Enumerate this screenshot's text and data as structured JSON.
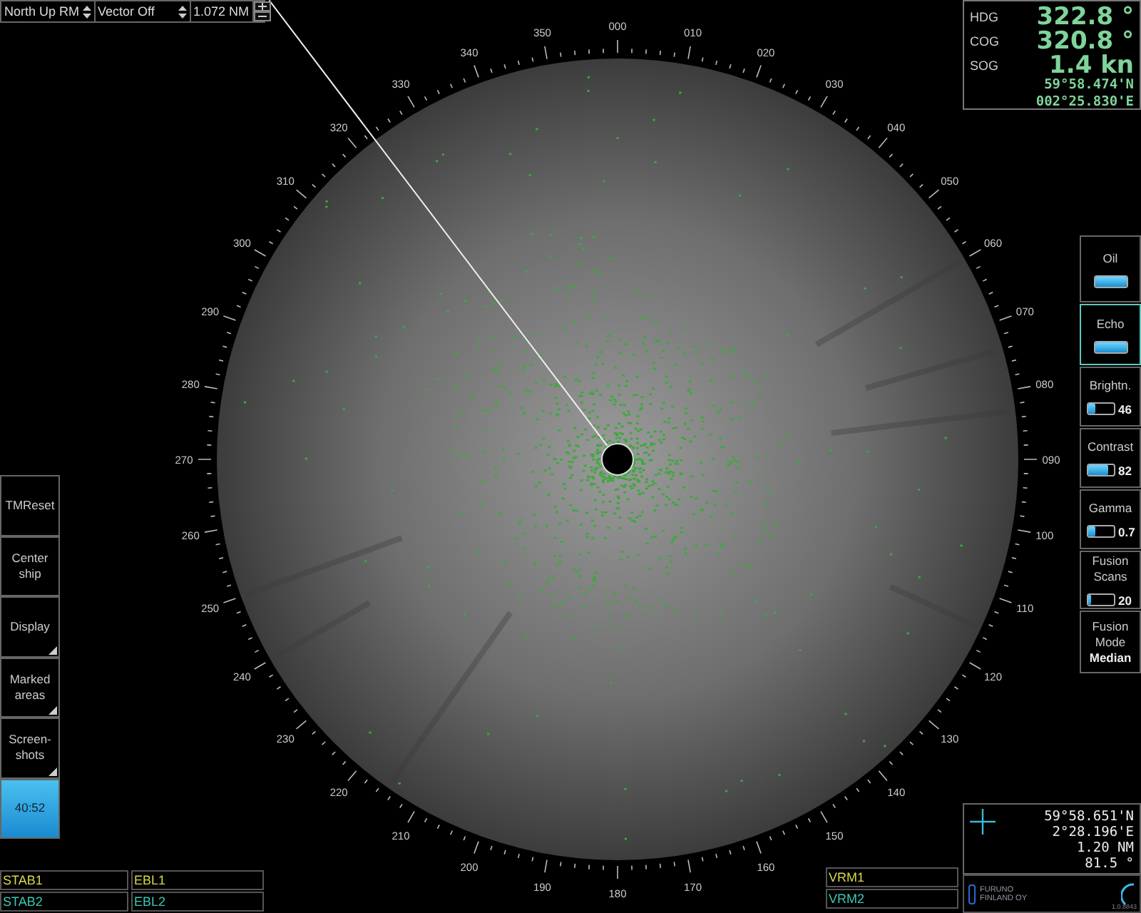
{
  "toolbar": {
    "orientation": "North Up RM",
    "vector": "Vector Off",
    "range": "1.072 NM"
  },
  "nav": [
    {
      "label": "HDG",
      "value": "322.8 °"
    },
    {
      "label": "COG",
      "value": "320.8 °"
    },
    {
      "label": "SOG",
      "value": "1.4 kn"
    }
  ],
  "position": {
    "lat": "59°58.474'N",
    "lon": "002°25.830'E"
  },
  "controls": [
    {
      "kind": "toggle",
      "label": "Oil",
      "on": true,
      "selected": false
    },
    {
      "kind": "toggle",
      "label": "Echo",
      "on": true,
      "selected": true
    },
    {
      "kind": "slider",
      "label": "Brightn.",
      "level": 0.3,
      "reading": "46",
      "selected": false
    },
    {
      "kind": "slider",
      "label": "Contrast",
      "level": 0.8,
      "reading": "82",
      "selected": false
    },
    {
      "kind": "slider",
      "label": "Gamma",
      "level": 0.25,
      "reading": "0.7",
      "selected": false
    },
    {
      "kind": "slider",
      "label": "Fusion Scans",
      "level": 0.1,
      "reading": "20",
      "selected": false
    },
    {
      "kind": "value",
      "label": "Fusion Mode",
      "value": "Median",
      "selected": false
    }
  ],
  "menu": [
    {
      "label": "TMReset",
      "submenu": false,
      "highlighted": false
    },
    {
      "label": "Center ship",
      "submenu": false,
      "highlighted": false
    },
    {
      "label": "Display",
      "submenu": true,
      "highlighted": false
    },
    {
      "label": "Marked areas",
      "submenu": true,
      "highlighted": false
    },
    {
      "label": "Screen-shots",
      "submenu": true,
      "highlighted": false
    },
    {
      "label": "40:52",
      "submenu": false,
      "highlighted": true
    }
  ],
  "bottom_left": [
    [
      {
        "label": "STAB1",
        "color": "#d8d84a"
      },
      {
        "label": "EBL1",
        "color": "#d8d84a"
      }
    ],
    [
      {
        "label": "STAB2",
        "color": "#3cc8b4"
      },
      {
        "label": "EBL2",
        "color": "#3cc8b4"
      }
    ]
  ],
  "vrm": [
    {
      "label": "VRM1",
      "color": "#d8d84a"
    },
    {
      "label": "VRM2",
      "color": "#3cc8b4"
    }
  ],
  "cursor": {
    "lat": "59°58.651'N",
    "lon": "2°28.196'E",
    "range": "1.20 NM",
    "bearing": "81.5 °"
  },
  "logo": {
    "name": "FURUNO",
    "sub": "FINLAND OY",
    "version": "1.0.8843"
  },
  "radar": {
    "heading_line": true,
    "bearing_labels": [
      "000",
      "010",
      "020",
      "030",
      "040",
      "050",
      "060",
      "070",
      "080",
      "090",
      "100",
      "110",
      "120",
      "130",
      "140",
      "150",
      "160",
      "170",
      "180",
      "190",
      "200",
      "210",
      "220",
      "230",
      "240",
      "250",
      "260",
      "270",
      "280",
      "290",
      "300",
      "310",
      "320",
      "330",
      "340",
      "350"
    ]
  }
}
